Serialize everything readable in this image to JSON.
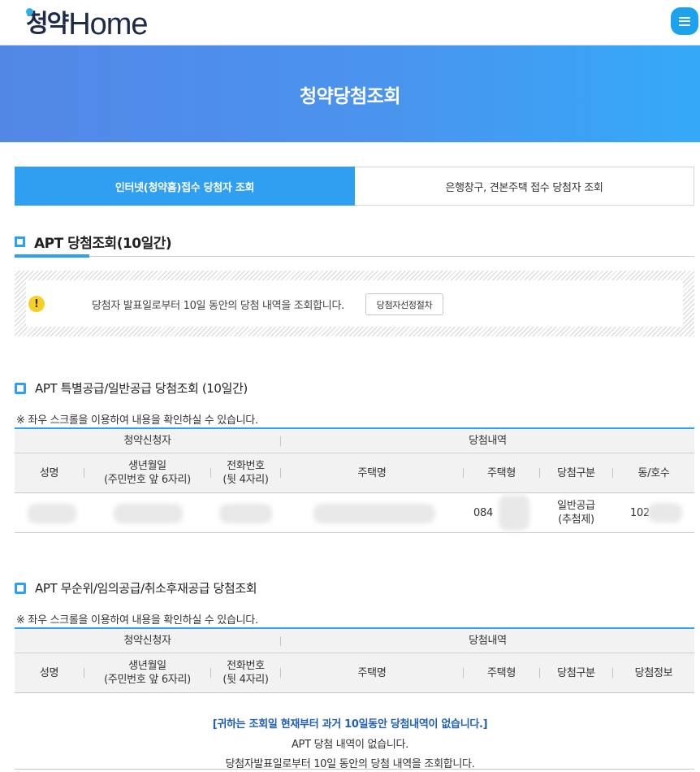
{
  "header": {
    "logo_han": "청약",
    "logo_home": "Home",
    "menu_icon": "hamburger-menu-icon"
  },
  "banner": {
    "title": "청약당첨조회"
  },
  "tabs": [
    {
      "label": "인터넷(청약홈)접수 당첨자 조회",
      "active": true
    },
    {
      "label": "은행창구, 견본주택 접수 당첨자 조회",
      "active": false
    }
  ],
  "section_main": {
    "title": "APT 당첨조회(10일간)"
  },
  "notice": {
    "icon": "exclamation-icon",
    "text": "당첨자 발표일로부터 10일 동안의 당첨 내역을 조회합니다.",
    "button_label": "당첨자선정절차"
  },
  "table1": {
    "title": "APT 특별공급/일반공급 당첨조회 (10일간)",
    "scroll_note": "※ 좌우 스크롤을 이용하여 내용을 확인하실 수 있습니다.",
    "groups": [
      "청약신청자",
      "당첨내역"
    ],
    "columns": [
      [
        "성명"
      ],
      [
        "생년월일",
        "(주민번호 앞 6자리)"
      ],
      [
        "전화번호",
        "(뒷 4자리)"
      ],
      [
        "주택명"
      ],
      [
        "주택형"
      ],
      [
        "당첨구분"
      ],
      [
        "동/호수"
      ]
    ],
    "row": {
      "house_type": "084",
      "win_type_line1": "일반공급",
      "win_type_line2": "(추첨제)",
      "dong": "102"
    }
  },
  "table2": {
    "title": "APT 무순위/임의공급/취소후재공급 당첨조회",
    "scroll_note": "※ 좌우 스크롤을 이용하여 내용을 확인하실 수 있습니다.",
    "groups": [
      "청약신청자",
      "당첨내역"
    ],
    "columns": [
      [
        "성명"
      ],
      [
        "생년월일",
        "(주민번호 앞 6자리)"
      ],
      [
        "전화번호",
        "(뒷 4자리)"
      ],
      [
        "주택명"
      ],
      [
        "주택형"
      ],
      [
        "당첨구분"
      ],
      [
        "당첨정보"
      ]
    ],
    "empty_messages": [
      "[귀하는 조회일 현재부터 과거 10일동안 당첨내역이 없습니다.]",
      "APT 당첨 내역이 없습니다.",
      "당첨자발표일로부터 10일 동안의 당첨 내역을 조회합니다."
    ]
  },
  "colors": {
    "accent": "#2f9ff2",
    "banner_start": "#5387e6",
    "banner_end": "#35a9f8",
    "warning": "#f7d027",
    "empty_highlight": "#1f5fb8"
  }
}
